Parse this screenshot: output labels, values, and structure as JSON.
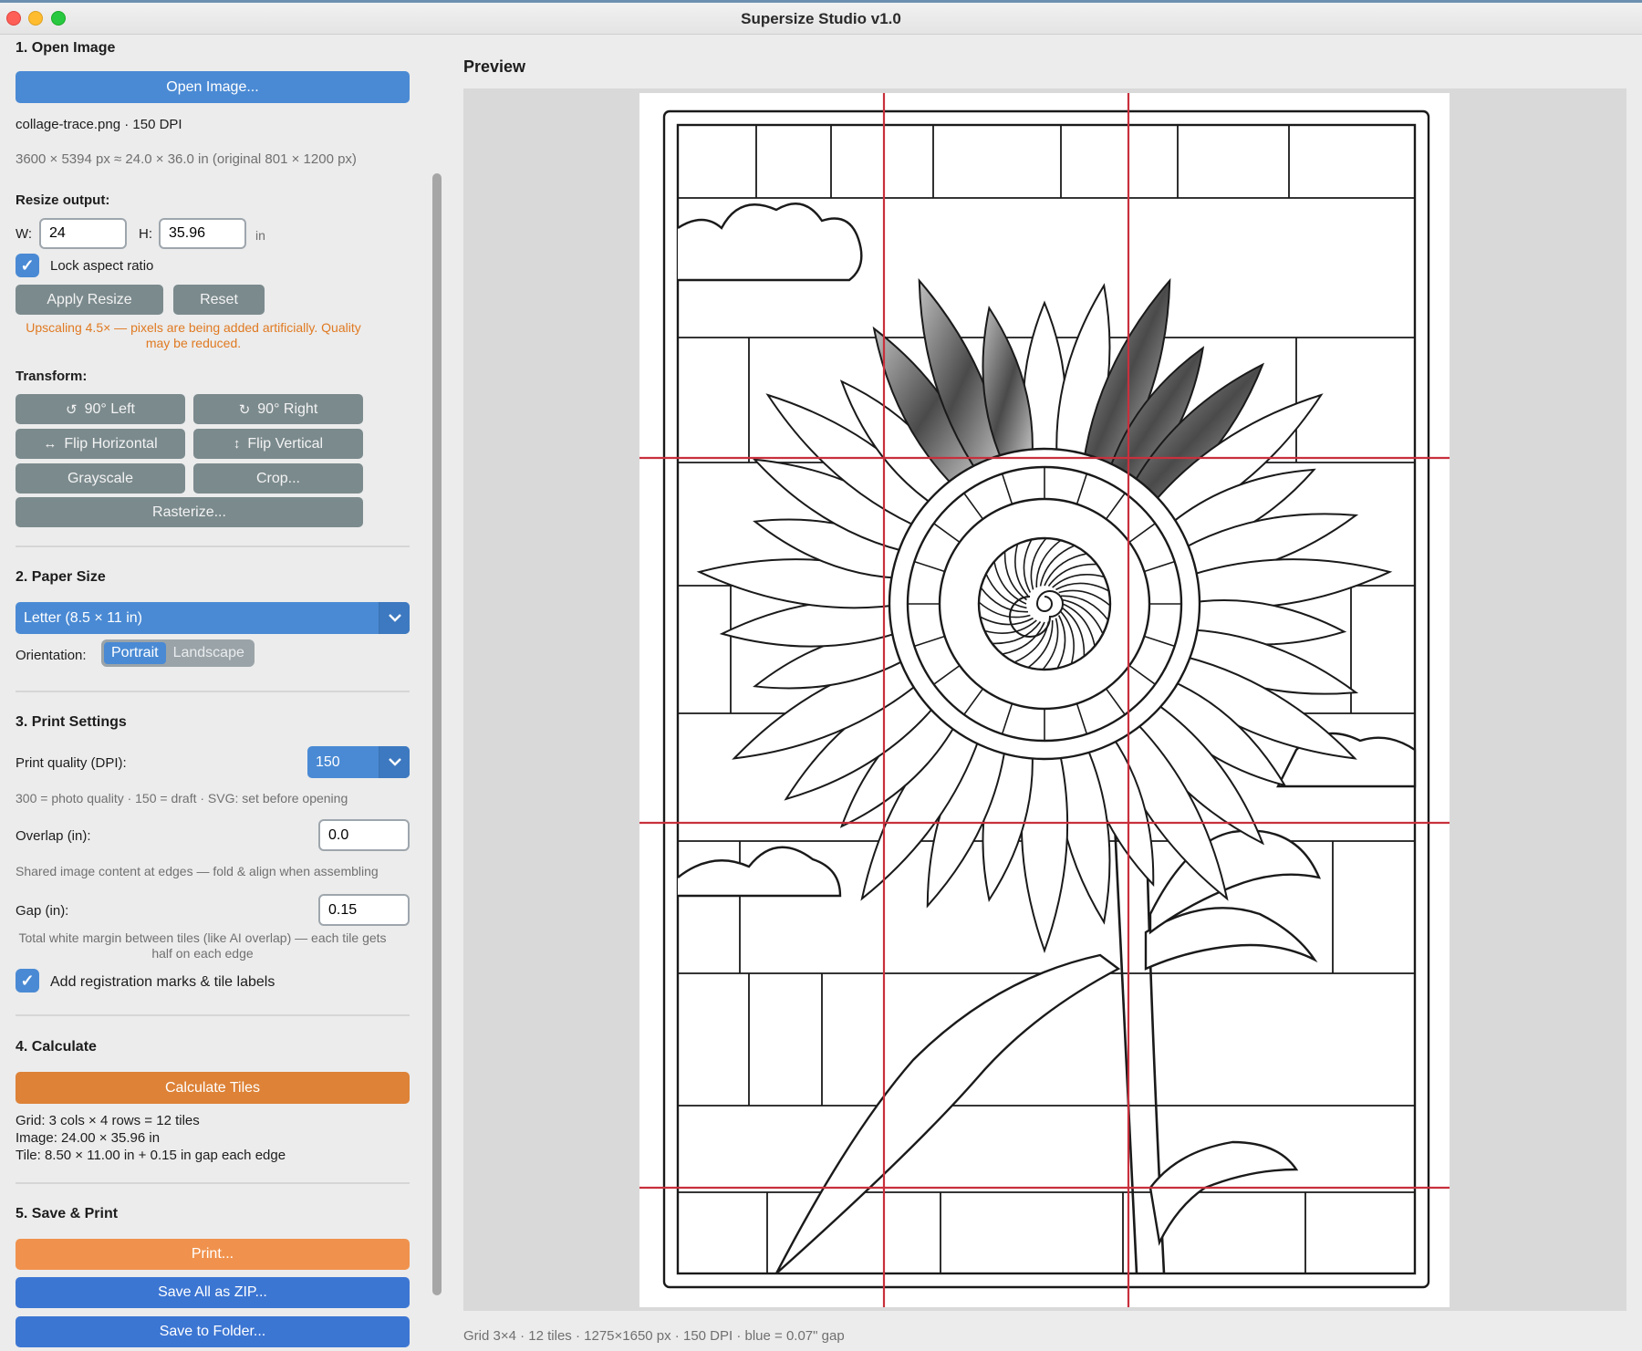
{
  "window": {
    "title": "Supersize Studio v1.0"
  },
  "section1": {
    "title": "1.  Open Image",
    "open_button": "Open Image...",
    "file_info": "collage-trace.png  · 150 DPI",
    "dims_info": "3600 × 5394 px  ≈  24.0 × 36.0 in  (original 801 × 1200 px)",
    "resize_label": "Resize output:",
    "w_label": "W:",
    "w_value": "24",
    "h_label": "H:",
    "h_value": "35.96",
    "unit": "in",
    "lock_label": "Lock aspect ratio",
    "apply_button": "Apply Resize",
    "reset_button": "Reset",
    "warning": "Upscaling 4.5× — pixels are being added artificially. Quality may be reduced.",
    "transform_label": "Transform:",
    "rotate_left": "90° Left",
    "rotate_right": "90° Right",
    "flip_h": "Flip Horizontal",
    "flip_v": "Flip Vertical",
    "grayscale": "Grayscale",
    "crop": "Crop...",
    "rasterize": "Rasterize..."
  },
  "section2": {
    "title": "2.  Paper Size",
    "paper_value": "Letter  (8.5 × 11 in)",
    "orientation_label": "Orientation:",
    "portrait": "Portrait",
    "landscape": "Landscape"
  },
  "section3": {
    "title": "3.  Print Settings",
    "dpi_label": "Print quality (DPI):",
    "dpi_value": "150",
    "dpi_hint": "300 = photo quality   ·   150 = draft   ·   SVG: set before opening",
    "overlap_label": "Overlap (in):",
    "overlap_value": "0.0",
    "overlap_hint": "Shared image content at edges — fold & align when assembling",
    "gap_label": "Gap (in):",
    "gap_value": "0.15",
    "gap_hint": "Total white margin between tiles (like AI overlap) — each tile gets half on each edge",
    "marks_label": "Add registration marks & tile labels"
  },
  "section4": {
    "title": "4.  Calculate",
    "calc_button": "Calculate Tiles",
    "grid_line": "Grid: 3 cols × 4 rows  =  12 tiles",
    "image_line": "Image: 24.00 × 35.96 in",
    "tile_line": "Tile: 8.50 × 11.00 in + 0.15 in gap each edge"
  },
  "section5": {
    "title": "5.  Save & Print",
    "print_button": "Print...",
    "zip_button": "Save All as ZIP...",
    "folder_button": "Save to Folder..."
  },
  "preview": {
    "title": "Preview",
    "grid_cols": 3,
    "grid_rows": 4,
    "status": "Grid 3×4  ·  12 tiles  ·  1275×1650 px  ·  150 DPI  ·  blue = 0.07\" gap"
  },
  "colors": {
    "accent_blue": "#4a8ad4",
    "accent_orange": "#dd8237",
    "grid_line_red": "#c8303c",
    "warning_orange": "#e07a22"
  },
  "icons": {
    "rotate_left": "rotate-left-icon",
    "rotate_right": "rotate-right-icon",
    "flip_h": "flip-horizontal-icon",
    "flip_v": "flip-vertical-icon",
    "checkmark": "checkmark-icon",
    "chevron": "chevron-down-icon"
  }
}
